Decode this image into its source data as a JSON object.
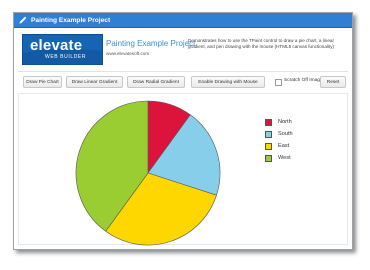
{
  "window": {
    "title": "Painting Example Project"
  },
  "banner": {
    "logo_text": "elevate",
    "logo_subtext": "WEB BUILDER"
  },
  "header": {
    "project_title": "Painting Example Project",
    "url": "www.elevatesoft.com",
    "description": "Demonstrates how to use the TPaint control to draw a pie chart, a linear gradient, and pen drawing with the mouse (HTML5 canvas functionality)"
  },
  "toolbar": {
    "draw_pie_chart": "Draw Pie Chart",
    "draw_linear_gradient": "Draw Linear Gradient",
    "draw_radial_gradient": "Draw Radial Gradient",
    "enable_drawing": "Enable Drawing with Mouse",
    "scratch_off": "Scratch Off Images",
    "reset": "Reset"
  },
  "chart_data": {
    "type": "pie",
    "title": "",
    "series": [
      {
        "label": "North",
        "value": 10,
        "color": "#dc143c"
      },
      {
        "label": "South",
        "value": 20,
        "color": "#87ceeb"
      },
      {
        "label": "East",
        "value": 30,
        "color": "#ffd700"
      },
      {
        "label": "West",
        "value": 40,
        "color": "#9acd32"
      }
    ],
    "start_angle_deg": -90,
    "direction": "clockwise",
    "legend_position": "right"
  }
}
